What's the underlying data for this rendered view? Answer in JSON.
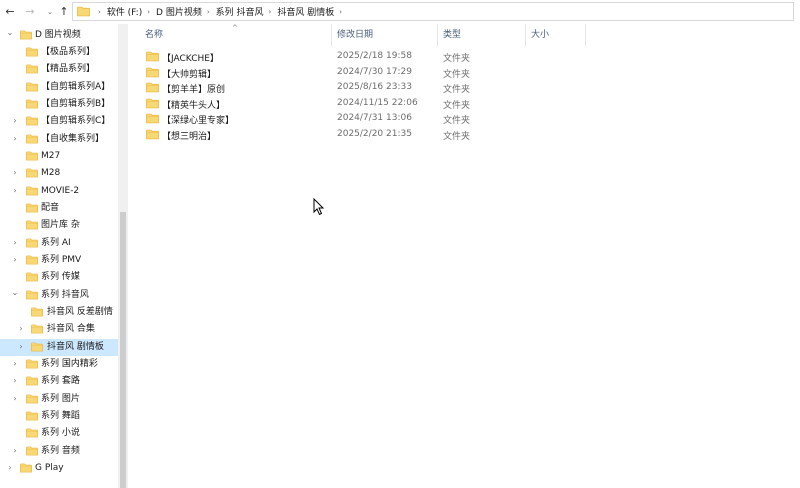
{
  "nav": {
    "back_icon": "←",
    "forward_icon": "→",
    "recent_icon": "⌄",
    "up_icon": "↑"
  },
  "address": {
    "breadcrumbs": [
      "软件 (F:)",
      "D  图片视频",
      "系列 抖音风",
      "抖音风 剧情板"
    ]
  },
  "sidebar": {
    "items": [
      {
        "label": "D  图片视频",
        "expanded": true,
        "has_children": true
      },
      {
        "label": "【极品系列】",
        "has_children": false
      },
      {
        "label": "【精品系列】",
        "has_children": false
      },
      {
        "label": "【自剪辑系列A】",
        "has_children": false
      },
      {
        "label": "【自剪辑系列B】",
        "has_children": false
      },
      {
        "label": "【自剪辑系列C】",
        "has_children": true
      },
      {
        "label": "【自收集系列】",
        "has_children": true
      },
      {
        "label": "M27",
        "has_children": false
      },
      {
        "label": "M28",
        "has_children": true
      },
      {
        "label": "MOVIE-2",
        "has_children": true
      },
      {
        "label": "配音",
        "has_children": false
      },
      {
        "label": "图片库 杂",
        "has_children": false
      },
      {
        "label": "系列 AI",
        "has_children": true
      },
      {
        "label": "系列 PMV",
        "has_children": true
      },
      {
        "label": "系列 传媒",
        "has_children": false
      },
      {
        "label": "系列 抖音风",
        "expanded": true,
        "has_children": true
      },
      {
        "label": "抖音风 反差剧情",
        "has_children": false
      },
      {
        "label": "抖音风 合集",
        "has_children": true
      },
      {
        "label": "抖音风 剧情板",
        "has_children": true,
        "selected": true
      },
      {
        "label": "系列 国内精彩",
        "has_children": true
      },
      {
        "label": "系列 套路",
        "has_children": true
      },
      {
        "label": "系列 图片",
        "has_children": true
      },
      {
        "label": "系列 舞蹈",
        "has_children": false
      },
      {
        "label": "系列 小说",
        "has_children": false
      },
      {
        "label": "系列 音频",
        "has_children": true
      },
      {
        "label": "G  Play",
        "has_children": true
      }
    ]
  },
  "columns": {
    "name": "名称",
    "date": "修改日期",
    "type": "类型",
    "size": "大小"
  },
  "files": [
    {
      "name": "【JACKCHE】",
      "date": "2025/2/18 19:58",
      "type": "文件夹"
    },
    {
      "name": "【大帅剪辑】",
      "date": "2024/7/30 17:29",
      "type": "文件夹"
    },
    {
      "name": "【剪羊羊】原创",
      "date": "2025/8/16 23:33",
      "type": "文件夹"
    },
    {
      "name": "【精英牛头人】",
      "date": "2024/11/15 22:06",
      "type": "文件夹"
    },
    {
      "name": "【深绿心里专家】",
      "date": "2024/7/31 13:06",
      "type": "文件夹"
    },
    {
      "name": "【想三明治】",
      "date": "2025/2/20 21:35",
      "type": "文件夹"
    }
  ],
  "colors": {
    "folder": "#f8d775",
    "folder_dark": "#e8b43a",
    "selected": "#cce8ff",
    "header_text": "#4c607a"
  }
}
